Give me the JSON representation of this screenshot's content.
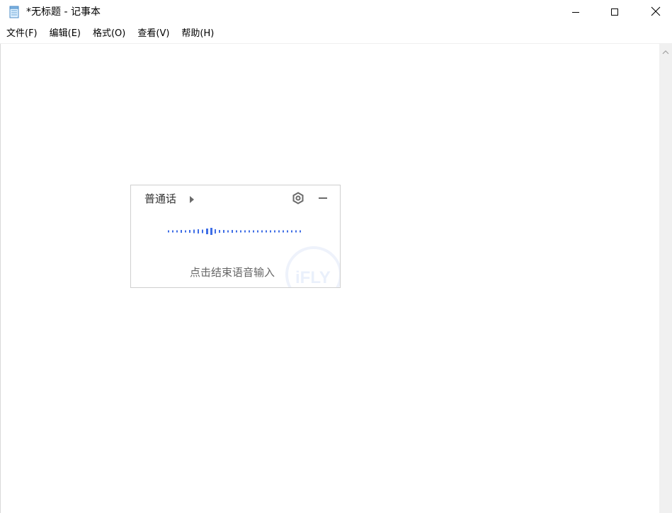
{
  "window": {
    "title": "*无标题 - 记事本",
    "app_icon": "notepad-icon",
    "controls": {
      "minimize": "minimize-icon",
      "maximize": "maximize-icon",
      "close": "close-icon"
    }
  },
  "menubar": {
    "items": [
      {
        "label": "文件(F)"
      },
      {
        "label": "编辑(E)"
      },
      {
        "label": "格式(O)"
      },
      {
        "label": "查看(V)"
      },
      {
        "label": "帮助(H)"
      }
    ]
  },
  "editor": {
    "content": ""
  },
  "voice_input": {
    "language": "普通话",
    "hint": "点击结束语音输入",
    "watermark": "iFLY",
    "accent_color": "#3f6ee6",
    "icons": {
      "language_dropdown": "caret-right-icon",
      "settings": "gear-icon",
      "collapse": "minus-icon",
      "waveform": "audio-waveform-icon"
    }
  }
}
